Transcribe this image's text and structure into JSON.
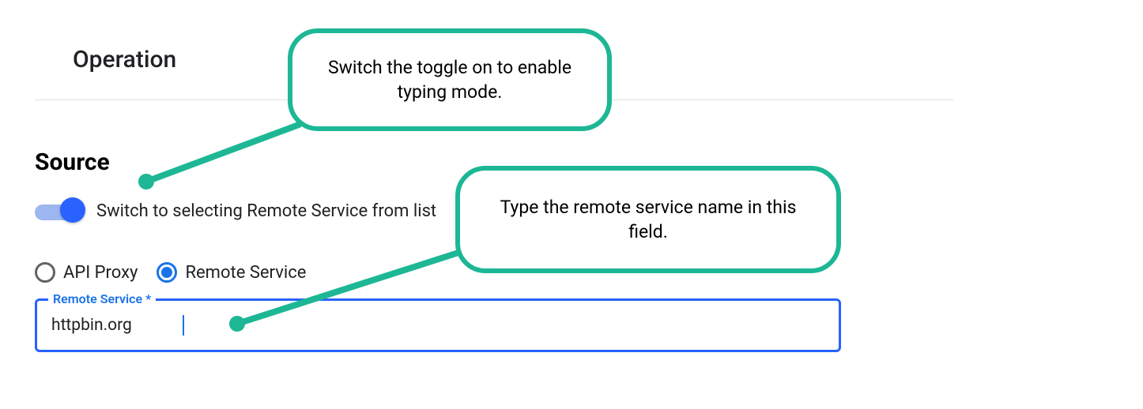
{
  "colors": {
    "accent_green": "#1db795",
    "primary_blue": "#2962ff",
    "link_blue": "#1a73e8"
  },
  "headings": {
    "operation": "Operation",
    "source": "Source"
  },
  "toggle": {
    "label": "Switch to selecting Remote Service from list",
    "on": true
  },
  "radios": {
    "api_proxy": {
      "label": "API Proxy",
      "checked": false
    },
    "remote_service": {
      "label": "Remote Service",
      "checked": true
    }
  },
  "field": {
    "floating_label": "Remote Service *",
    "value": "httpbin.org"
  },
  "callouts": {
    "toggle_hint": "Switch the toggle on to enable typing mode.",
    "field_hint": "Type the remote service name in this field."
  }
}
